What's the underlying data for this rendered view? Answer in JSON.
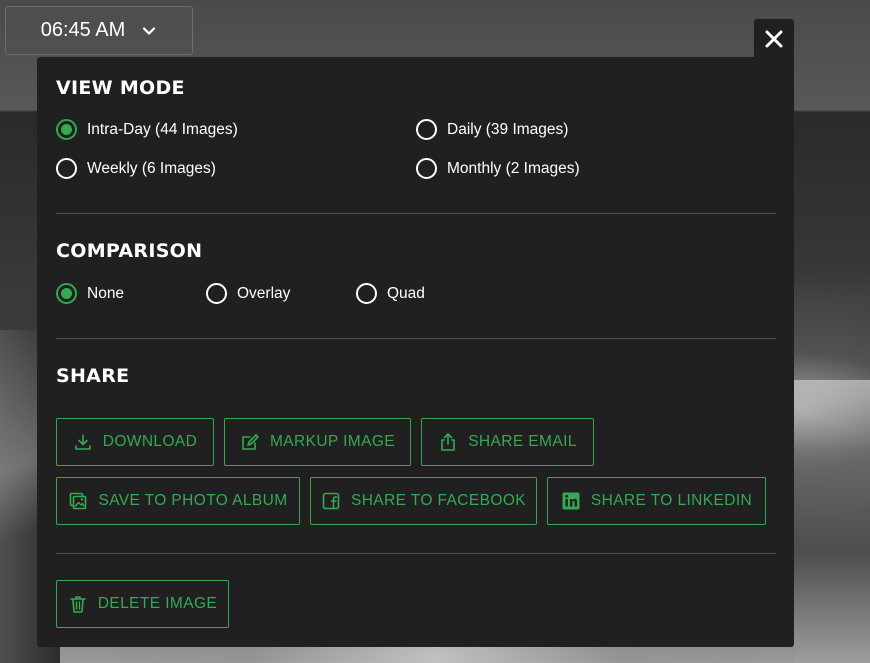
{
  "time_select": {
    "value": "06:45 AM"
  },
  "view_mode": {
    "title": "VIEW MODE",
    "options": [
      {
        "label": "Intra-Day (44 Images)",
        "selected": true
      },
      {
        "label": "Daily (39 Images)",
        "selected": false
      },
      {
        "label": "Weekly (6 Images)",
        "selected": false
      },
      {
        "label": "Monthly (2 Images)",
        "selected": false
      }
    ]
  },
  "comparison": {
    "title": "COMPARISON",
    "options": [
      {
        "label": "None",
        "selected": true
      },
      {
        "label": "Overlay",
        "selected": false
      },
      {
        "label": "Quad",
        "selected": false
      }
    ]
  },
  "share": {
    "title": "SHARE",
    "buttons": [
      {
        "label": "DOWNLOAD",
        "icon": "download-icon"
      },
      {
        "label": "MARKUP IMAGE",
        "icon": "markup-icon"
      },
      {
        "label": "SHARE EMAIL",
        "icon": "share-icon"
      },
      {
        "label": "SAVE TO PHOTO ALBUM",
        "icon": "photo-album-icon"
      },
      {
        "label": "SHARE TO FACEBOOK",
        "icon": "facebook-icon"
      },
      {
        "label": "SHARE TO LINKEDIN",
        "icon": "linkedin-icon"
      }
    ]
  },
  "delete": {
    "label": "DELETE IMAGE",
    "icon": "trash-icon"
  },
  "colors": {
    "accent": "#35a953",
    "panel": "#202020",
    "divider": "#4e4e4e"
  }
}
